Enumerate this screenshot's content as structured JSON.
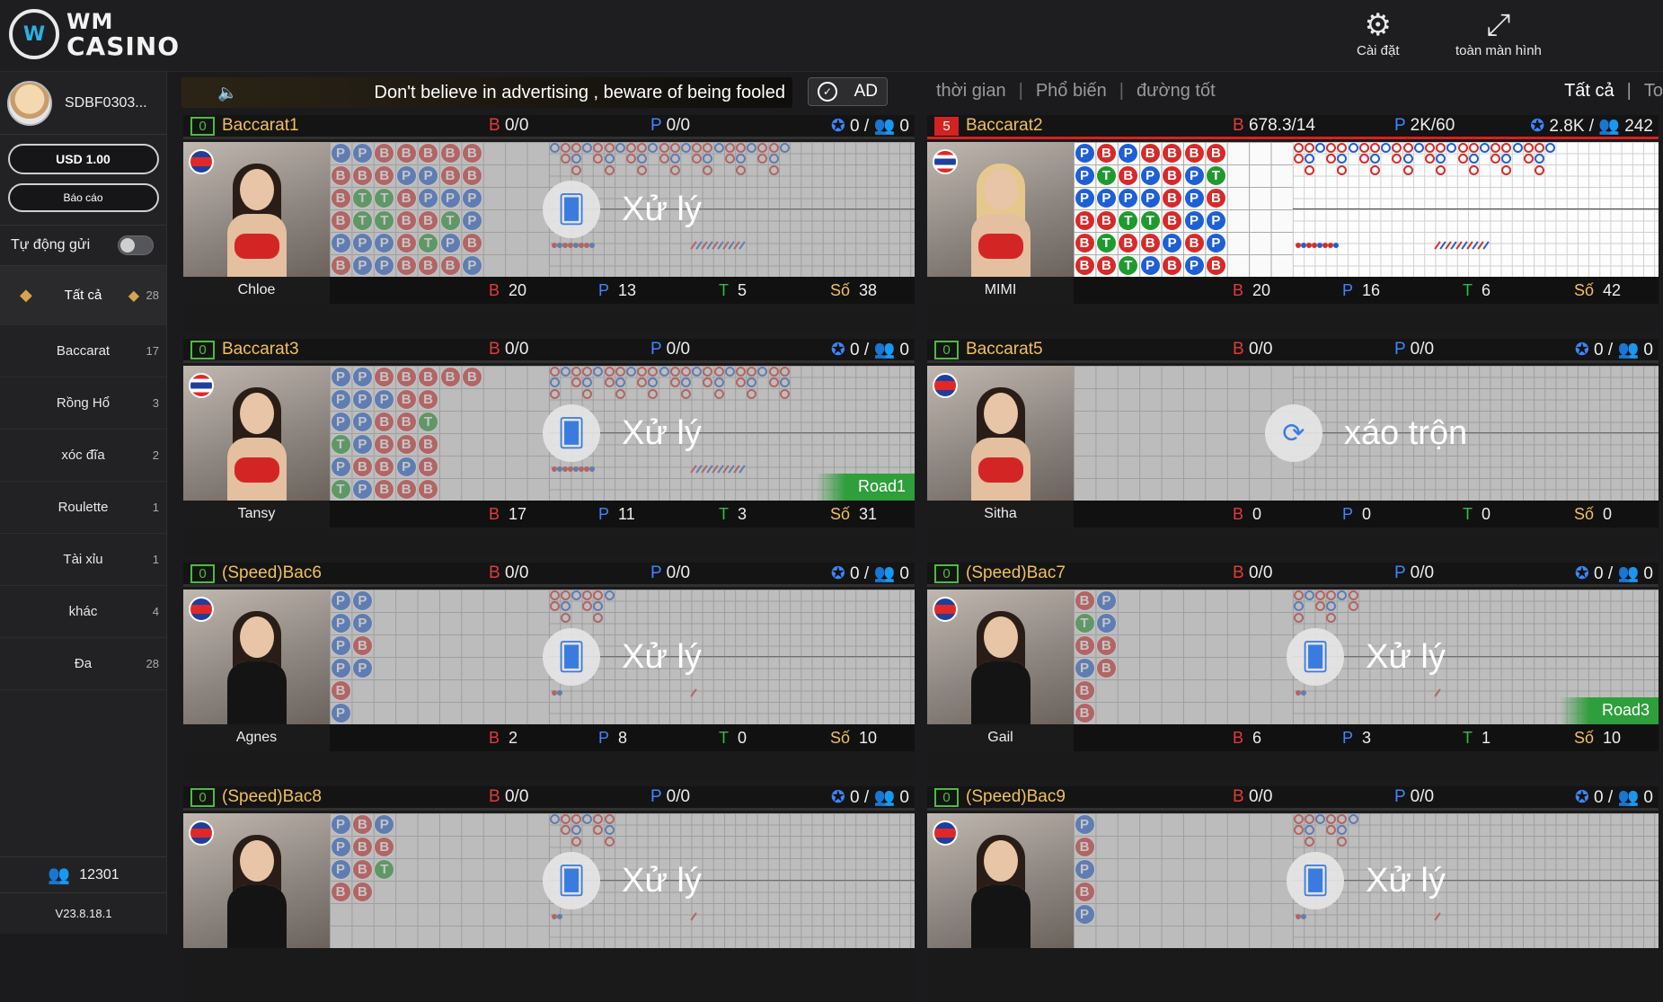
{
  "header": {
    "logo_mark": "W",
    "logo_line1": "WM",
    "logo_line2": "CASINO",
    "settings_label": "Cài đặt",
    "fullscreen_label": "toàn màn hình"
  },
  "sidebar": {
    "username": "SDBF0303...",
    "balance": "USD 1.00",
    "report": "Báo cáo",
    "auto_send": "Tự động gửi",
    "categories": [
      {
        "label": "Tất cả",
        "count": "28"
      },
      {
        "label": "Baccarat",
        "count": "17"
      },
      {
        "label": "Rồng Hổ",
        "count": "3"
      },
      {
        "label": "xóc đĩa",
        "count": "2"
      },
      {
        "label": "Roulette",
        "count": "1"
      },
      {
        "label": "Tài xỉu",
        "count": "1"
      },
      {
        "label": "khác",
        "count": "4"
      },
      {
        "label": "Đa",
        "count": "28"
      }
    ],
    "online": "12301",
    "version": "V23.8.18.1"
  },
  "topbar": {
    "notice": "Don't believe in advertising , beware of being fooled",
    "ad": "AD",
    "filters": [
      "thời gian",
      "Phổ biến",
      "đường tốt"
    ],
    "filters_right": [
      "Tất cả",
      "To"
    ]
  },
  "tables": [
    {
      "num": "0",
      "name": "Baccarat1",
      "hb": "0/0",
      "hp": "0/0",
      "hs": "0",
      "hu": "0",
      "dealer": "Chloe",
      "fb": "20",
      "fp": "13",
      "ft": "5",
      "fs": "38",
      "overlay": "Xử lý",
      "tag": ""
    },
    {
      "num": "5",
      "name": "Baccarat2",
      "hb": "678.3/14",
      "hp": "2K/60",
      "hs": "2.8K",
      "hu": "242",
      "dealer": "MIMI",
      "fb": "20",
      "fp": "16",
      "ft": "6",
      "fs": "42",
      "overlay": "",
      "tag": ""
    },
    {
      "num": "0",
      "name": "Baccarat3",
      "hb": "0/0",
      "hp": "0/0",
      "hs": "0",
      "hu": "0",
      "dealer": "Tansy",
      "fb": "17",
      "fp": "11",
      "ft": "3",
      "fs": "31",
      "overlay": "Xử lý",
      "tag": "Road1"
    },
    {
      "num": "0",
      "name": "Baccarat5",
      "hb": "0/0",
      "hp": "0/0",
      "hs": "0",
      "hu": "0",
      "dealer": "Sitha",
      "fb": "0",
      "fp": "0",
      "ft": "0",
      "fs": "0",
      "overlay": "xáo trộn",
      "tag": ""
    },
    {
      "num": "0",
      "name": "(Speed)Bac6",
      "hb": "0/0",
      "hp": "0/0",
      "hs": "0",
      "hu": "0",
      "dealer": "Agnes",
      "fb": "2",
      "fp": "8",
      "ft": "0",
      "fs": "10",
      "overlay": "Xử lý",
      "tag": ""
    },
    {
      "num": "0",
      "name": "(Speed)Bac7",
      "hb": "0/0",
      "hp": "0/0",
      "hs": "0",
      "hu": "0",
      "dealer": "Gail",
      "fb": "6",
      "fp": "3",
      "ft": "1",
      "fs": "10",
      "overlay": "Xử lý",
      "tag": "Road3"
    },
    {
      "num": "0",
      "name": "(Speed)Bac8",
      "hb": "0/0",
      "hp": "0/0",
      "hs": "0",
      "hu": "0",
      "dealer": "",
      "fb": "",
      "fp": "",
      "ft": "",
      "fs": "",
      "overlay": "Xử lý",
      "tag": ""
    },
    {
      "num": "0",
      "name": "(Speed)Bac9",
      "hb": "0/0",
      "hp": "0/0",
      "hs": "0",
      "hu": "0",
      "dealer": "",
      "fb": "",
      "fp": "",
      "ft": "",
      "fs": "",
      "overlay": "Xử lý",
      "tag": ""
    }
  ],
  "labels": {
    "B": "B",
    "P": "P",
    "T": "T",
    "So": "Số",
    "slash": "/"
  }
}
